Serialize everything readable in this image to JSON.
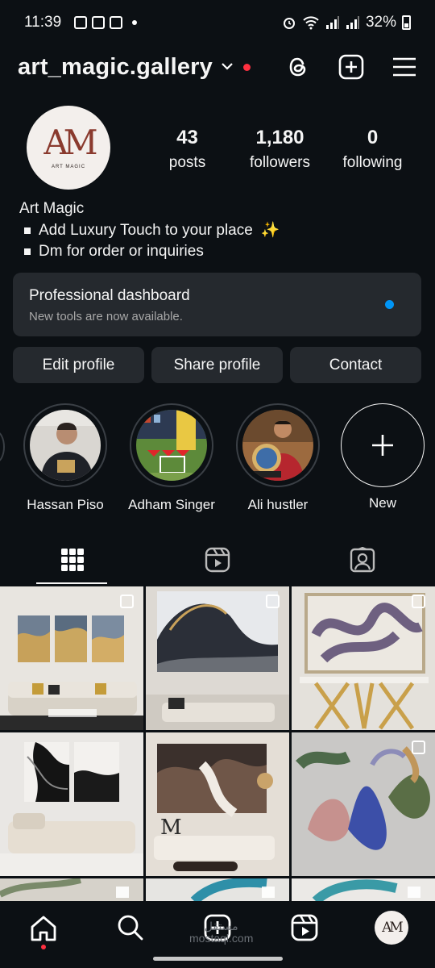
{
  "status_bar": {
    "time": "11:39",
    "battery": "32%"
  },
  "header": {
    "username": "art_magic.gallery",
    "chevron": "⌄"
  },
  "profile": {
    "avatar_monogram": "AM",
    "avatar_caption": "ART MAGIC",
    "stats": [
      {
        "value": "43",
        "label": "posts"
      },
      {
        "value": "1,180",
        "label": "followers"
      },
      {
        "value": "0",
        "label": "following"
      }
    ],
    "name": "Art Magic",
    "bio_lines": [
      "Add Luxury Touch to your place",
      "Dm for order or inquiries"
    ],
    "sparkle": "✨"
  },
  "dashboard": {
    "title": "Professional dashboard",
    "subtitle": "New tools are now available."
  },
  "buttons": {
    "edit": "Edit profile",
    "share": "Share profile",
    "contact": "Contact"
  },
  "highlights": [
    {
      "name": "Hassan Piso"
    },
    {
      "name": "Adham Singer"
    },
    {
      "name": "Ali hustler"
    },
    {
      "name": "New",
      "icon": "plus-icon"
    }
  ],
  "tabs": [
    "grid-icon",
    "reels-icon",
    "tagged-icon"
  ],
  "grid_posts": [
    {
      "type": "carousel",
      "desc": "triptych abstract over sofa"
    },
    {
      "type": "carousel",
      "desc": "wave painting over sofa"
    },
    {
      "type": "carousel",
      "desc": "ribbon painting over gold console"
    },
    {
      "type": "carousel",
      "desc": "black white abstract over sofa"
    },
    {
      "type": "single",
      "desc": "marble painting living room"
    },
    {
      "type": "carousel",
      "desc": "colorful leaves painting"
    }
  ],
  "bottom_nav": [
    "home-icon",
    "search-icon",
    "create-icon",
    "reels-icon",
    "profile-avatar"
  ],
  "watermark": {
    "line1": "مستقل",
    "line2": "mostaql.com"
  },
  "colors": {
    "background": "#0c1014",
    "surface": "#25292e",
    "accent_blue": "#0095f6",
    "notification_red": "#ff3040"
  }
}
